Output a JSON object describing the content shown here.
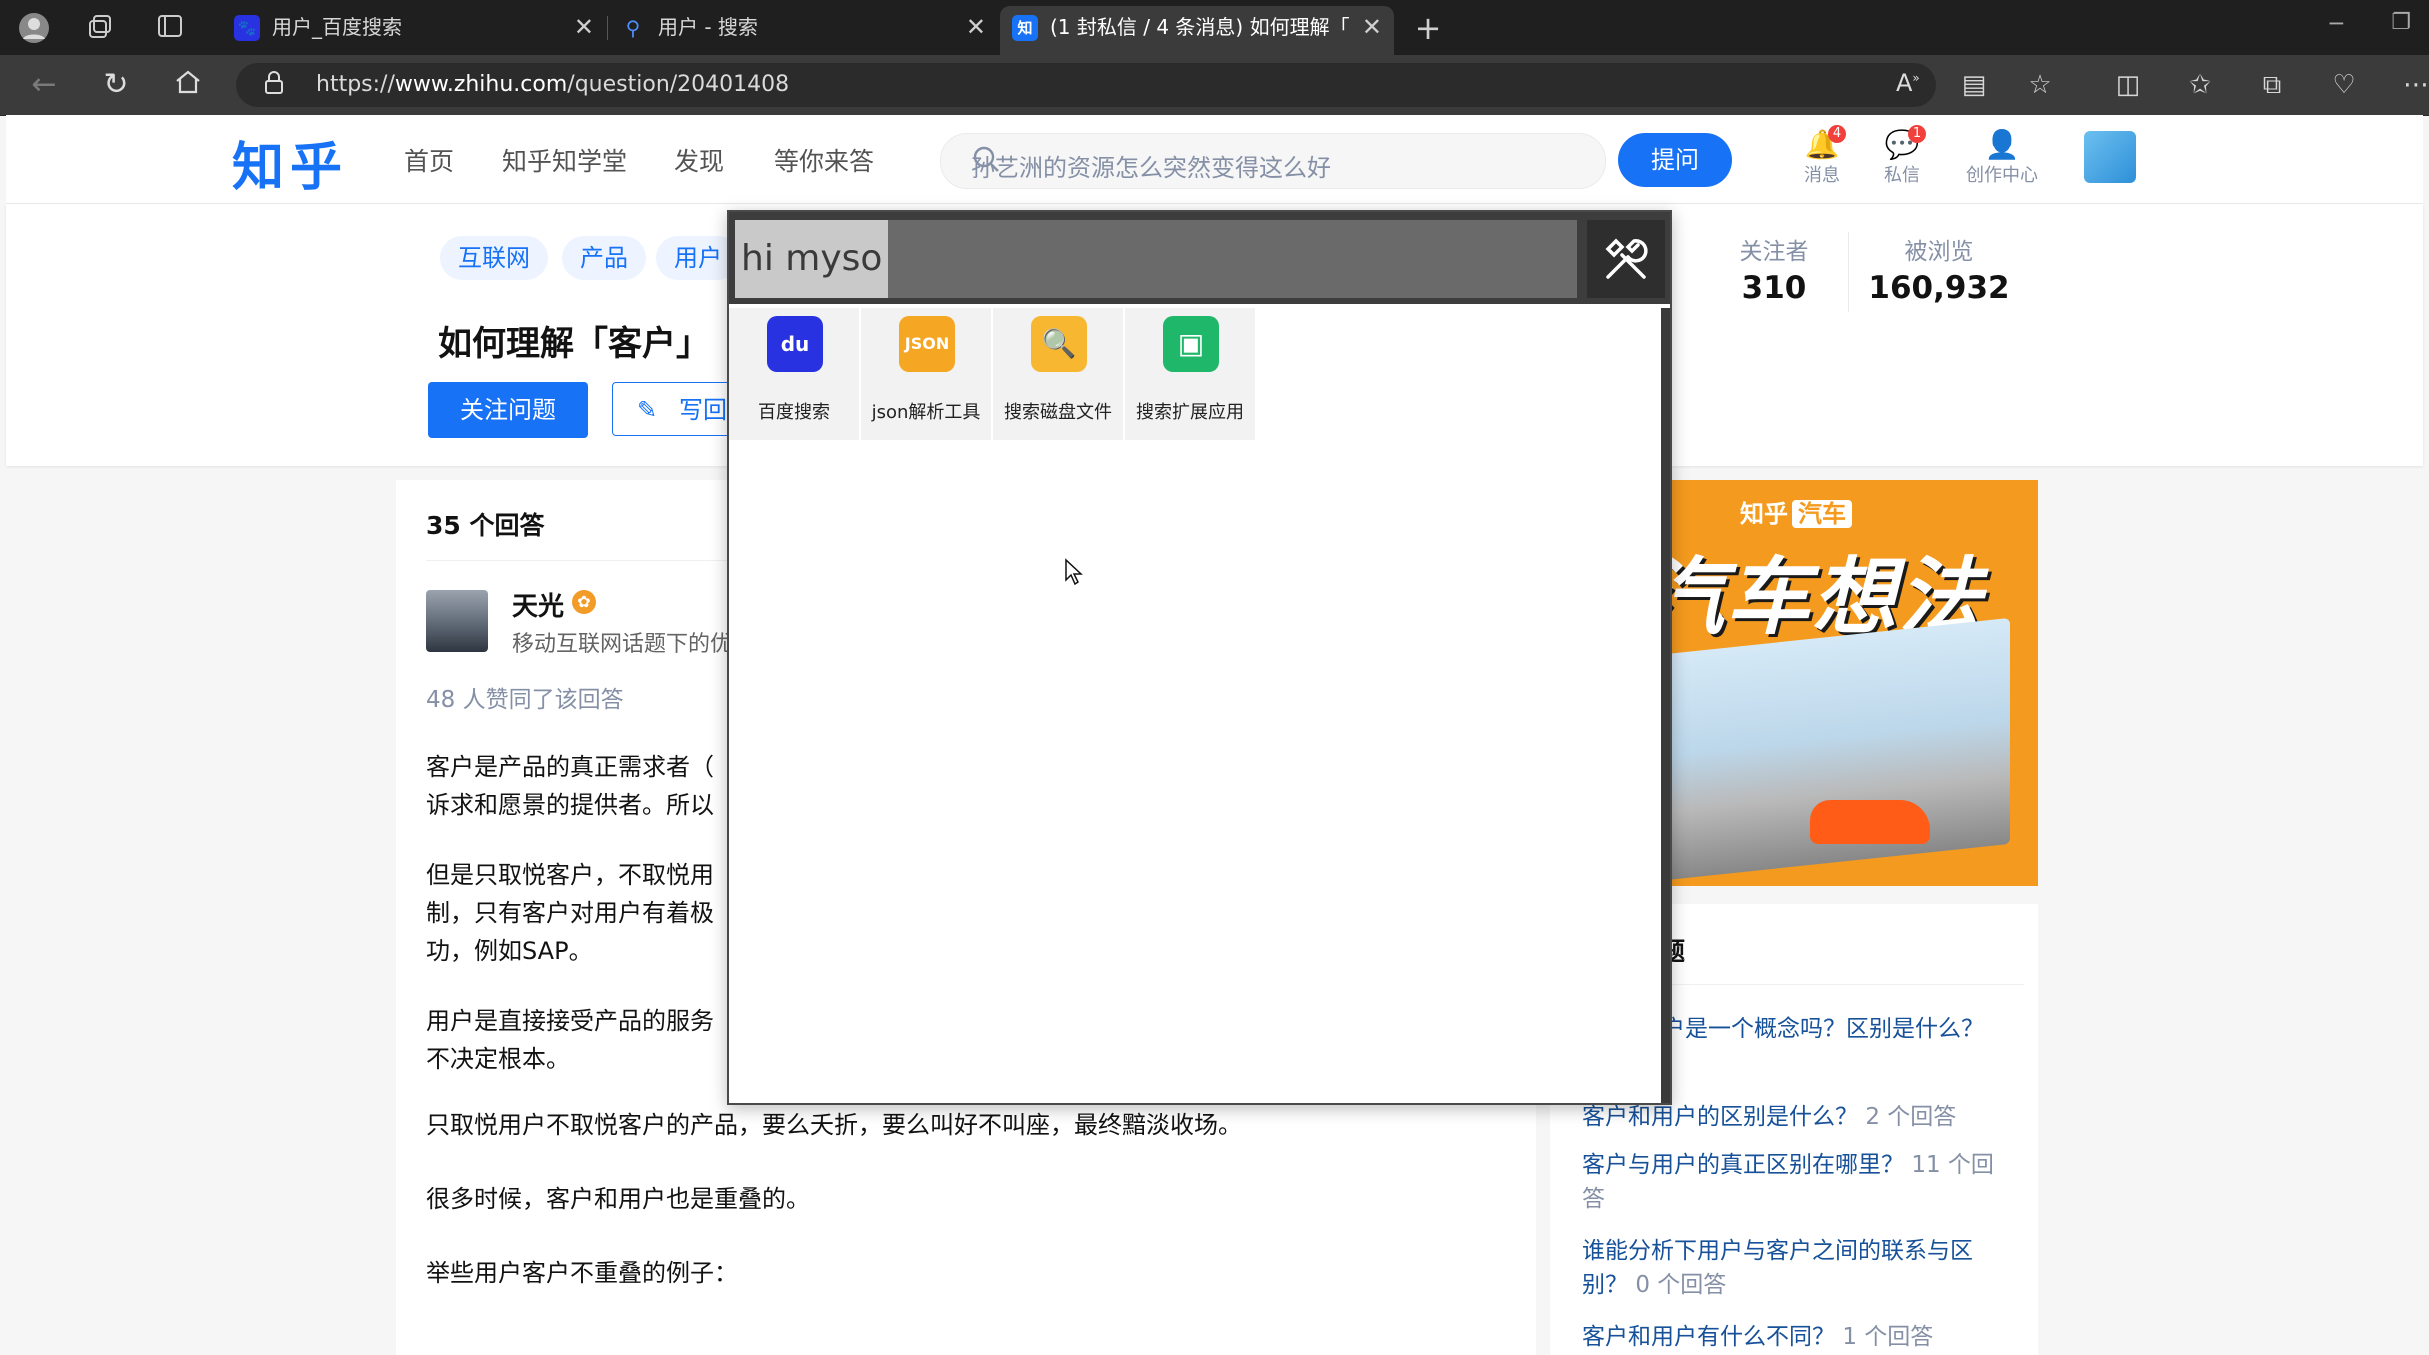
{
  "browser": {
    "tabs": [
      {
        "title": "用户_百度搜索",
        "favicon": "baidu-paw-icon",
        "active": false
      },
      {
        "title": "用户 - 搜索",
        "favicon": "search-icon",
        "active": false
      },
      {
        "title": "(1 封私信 / 4 条消息) 如何理解「",
        "favicon": "zhihu-icon",
        "active": true
      }
    ],
    "url_prefix": "https://",
    "url_host": "www.zhihu.com",
    "url_path": "/question/20401408"
  },
  "zhihu": {
    "logo": "知乎",
    "nav": [
      "首页",
      "知乎知学堂",
      "发现",
      "等你来答"
    ],
    "search_placeholder": "孙艺洲的资源怎么突然变得这么好",
    "ask_label": "提问",
    "header_icons": [
      {
        "label": "消息",
        "icon": "bell-icon",
        "badge": "4"
      },
      {
        "label": "私信",
        "icon": "chat-icon",
        "badge": "1"
      },
      {
        "label": "创作中心",
        "icon": "creator-icon",
        "badge": ""
      }
    ],
    "question": {
      "topics": [
        "互联网",
        "产品",
        "用户"
      ],
      "title": "如何理解「客户」",
      "follow_label": "关注问题",
      "write_label": "写回答",
      "followers_label": "关注者",
      "followers": "310",
      "views_label": "被浏览",
      "views": "160,932"
    },
    "answers": {
      "count_label": "35 个回答",
      "author_name": "天光",
      "author_bio": "移动互联网话题下的优",
      "likes": "48 人赞同了该回答",
      "paragraphs": [
        [
          "客户是产品的真正需求者（",
          "诉求和愿景的提供者。所以"
        ],
        [
          "但是只取悦客户，不取悦用",
          "制，只有客户对用户有着极",
          "功，例如SAP。"
        ],
        [
          "用户是直接接受产品的服务",
          "不决定根本。"
        ],
        [
          "只取悦用户不取悦客户的产品，要么夭折，要么叫好不叫座，最终黯淡收场。"
        ],
        [
          "很多时候，客户和用户也是重叠的。"
        ],
        [
          "举些用户客户不重叠的例子："
        ]
      ]
    },
    "ad": {
      "brand": "知乎",
      "brand_tag": "汽车",
      "slogan": "汽车想法"
    },
    "related": {
      "title_fragment": "题",
      "items": [
        {
          "text": "户是一个概念吗？区别是什么？",
          "count": ""
        },
        {
          "text": "客户和用户的区别是什么？",
          "count": "2 个回答"
        },
        {
          "text": "客户与用户的真正区别在哪里？",
          "count": "11 个回答"
        },
        {
          "text": "谁能分析下用户与客户之间的联系与区别？",
          "count": "0 个回答"
        },
        {
          "text": "客户和用户有什么不同？",
          "count": "1 个回答"
        }
      ]
    }
  },
  "launcher": {
    "query": "hi myso",
    "tools_icon": "tools-icon",
    "apps": [
      {
        "label": "百度搜索",
        "icon": "baidu-icon",
        "color": "#2932e1"
      },
      {
        "label": "json解析工具",
        "icon": "json-icon",
        "color": "#f5a623"
      },
      {
        "label": "搜索磁盘文件",
        "icon": "folder-search-icon",
        "color": "#f7b731"
      },
      {
        "label": "搜索扩展应用",
        "icon": "extension-app-icon",
        "color": "#1fb76a"
      }
    ]
  }
}
